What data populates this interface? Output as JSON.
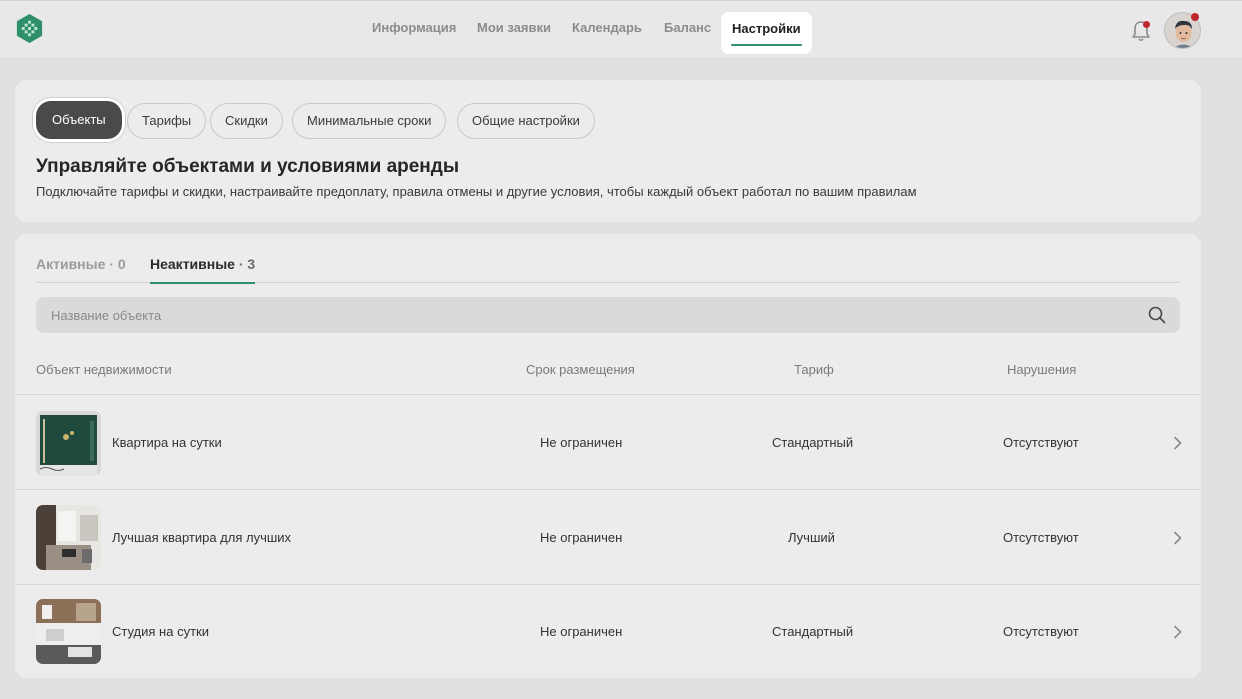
{
  "nav": {
    "items": [
      {
        "label": "Информация"
      },
      {
        "label": "Мои заявки"
      },
      {
        "label": "Календарь"
      },
      {
        "label": "Баланс"
      },
      {
        "label": "Настройки"
      }
    ],
    "active": "Настройки"
  },
  "settings_tabs": [
    {
      "label": "Объекты"
    },
    {
      "label": "Тарифы"
    },
    {
      "label": "Скидки"
    },
    {
      "label": "Минимальные сроки"
    },
    {
      "label": "Общие настройки"
    }
  ],
  "header": {
    "title": "Управляйте объектами и условиями аренды",
    "subtitle": "Подключайте тарифы и скидки, настраивайте предоплату, правила отмены и другие условия, чтобы каждый объект работал по вашим правилам"
  },
  "status_tabs": {
    "active": {
      "label": "Активные",
      "count": "· 0"
    },
    "inactive": {
      "label": "Неактивные",
      "count": "· 3"
    }
  },
  "search": {
    "placeholder": "Название объекта"
  },
  "table": {
    "columns": [
      "Объект недвижимости",
      "Срок размещения",
      "Тариф",
      "Нарушения"
    ],
    "rows": [
      {
        "name": "Квартира на сутки",
        "term": "Не ограничен",
        "tariff": "Стандартный",
        "violations": "Отсутствуют"
      },
      {
        "name": "Лучшая квартира для лучших",
        "term": "Не ограничен",
        "tariff": "Лучший",
        "violations": "Отсутствуют"
      },
      {
        "name": "Студия на сутки",
        "term": "Не ограничен",
        "tariff": "Стандартный",
        "violations": "Отсутствуют"
      }
    ]
  },
  "colors": {
    "accent": "#2f8f6a",
    "notification": "#c0272d"
  }
}
